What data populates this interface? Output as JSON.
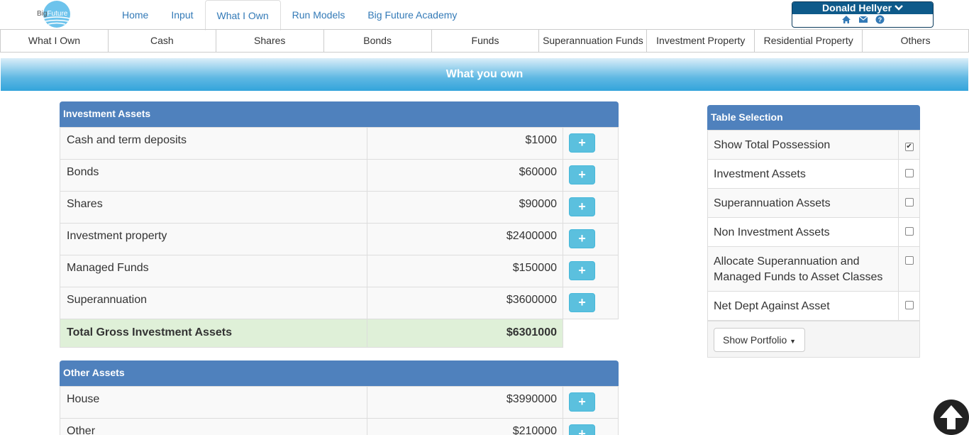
{
  "logo": {
    "big": "Big",
    "future": "Future"
  },
  "nav": [
    {
      "label": "Home"
    },
    {
      "label": "Input"
    },
    {
      "label": "What I Own",
      "active": true
    },
    {
      "label": "Run Models"
    },
    {
      "label": "Big Future Academy"
    }
  ],
  "user": {
    "name": "Donald Hellyer",
    "chevron": "⌄"
  },
  "subtabs": [
    "What I Own",
    "Cash",
    "Shares",
    "Bonds",
    "Funds",
    "Superannuation Funds",
    "Investment Property",
    "Residential Property",
    "Others"
  ],
  "banner": {
    "title": "What you own"
  },
  "investment_assets": {
    "title": "Investment Assets",
    "rows": [
      {
        "label": "Cash and term deposits",
        "value": "$1000"
      },
      {
        "label": "Bonds",
        "value": "$60000"
      },
      {
        "label": "Shares",
        "value": "$90000"
      },
      {
        "label": "Investment property",
        "value": "$2400000"
      },
      {
        "label": "Managed Funds",
        "value": "$150000"
      },
      {
        "label": "Superannuation",
        "value": "$3600000"
      }
    ],
    "total_label": "Total Gross Investment Assets",
    "total_value": "$6301000"
  },
  "other_assets": {
    "title": "Other Assets",
    "rows": [
      {
        "label": "House",
        "value": "$3990000"
      },
      {
        "label": "Other",
        "value": "$210000"
      }
    ]
  },
  "plus_label": "+",
  "table_selection": {
    "title": "Table Selection",
    "rows": [
      {
        "label": "Show Total Possession",
        "checked": true
      },
      {
        "label": "Investment Assets",
        "checked": false
      },
      {
        "label": "Superannuation Assets",
        "checked": false
      },
      {
        "label": "Non Investment Assets",
        "checked": false
      },
      {
        "label": "Allocate Superannuation and Managed Funds to Asset Classes",
        "checked": false
      },
      {
        "label": "Net Dept Against Asset",
        "checked": false
      }
    ],
    "portfolio_button": "Show Portfolio"
  },
  "colors": {
    "header_blue": "#4f81bd",
    "total_green": "#dff0d8",
    "plus_btn": "#5bc0de"
  }
}
